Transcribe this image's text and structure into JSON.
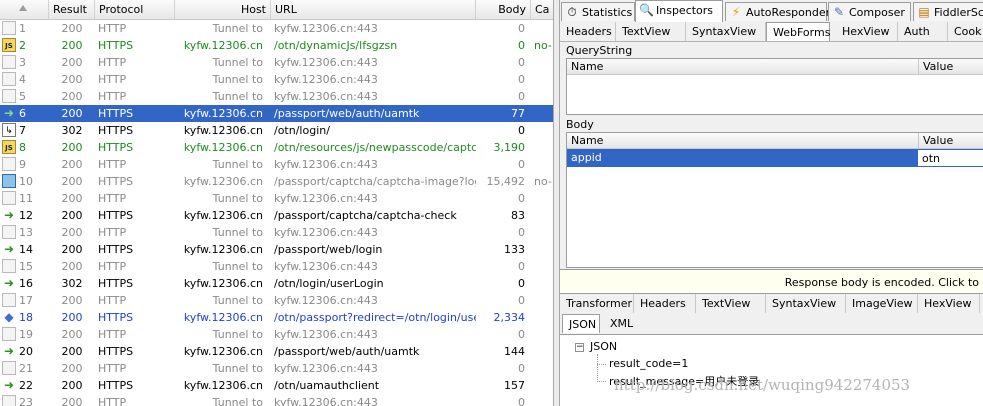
{
  "list": {
    "columns": [
      "Result",
      "Protocol",
      "Host",
      "URL",
      "Body",
      "Ca"
    ],
    "rows": [
      {
        "num": "1",
        "result": "200",
        "protocol": "HTTP",
        "host": "Tunnel to",
        "url": "kyfw.12306.cn:443",
        "body": "0",
        "cache": "",
        "icon": "tunnel",
        "color": "gray"
      },
      {
        "num": "2",
        "result": "200",
        "protocol": "HTTPS",
        "host": "kyfw.12306.cn",
        "url": "/otn/dynamicJs/lfsgzsn",
        "body": "0",
        "cache": "no-",
        "icon": "js",
        "color": "green"
      },
      {
        "num": "3",
        "result": "200",
        "protocol": "HTTP",
        "host": "Tunnel to",
        "url": "kyfw.12306.cn:443",
        "body": "0",
        "cache": "",
        "icon": "tunnel",
        "color": "gray"
      },
      {
        "num": "4",
        "result": "200",
        "protocol": "HTTP",
        "host": "Tunnel to",
        "url": "kyfw.12306.cn:443",
        "body": "0",
        "cache": "",
        "icon": "tunnel",
        "color": "gray"
      },
      {
        "num": "5",
        "result": "200",
        "protocol": "HTTP",
        "host": "Tunnel to",
        "url": "kyfw.12306.cn:443",
        "body": "0",
        "cache": "",
        "icon": "tunnel",
        "color": "gray"
      },
      {
        "num": "6",
        "result": "200",
        "protocol": "HTTPS",
        "host": "kyfw.12306.cn",
        "url": "/passport/web/auth/uamtk",
        "body": "77",
        "cache": "",
        "icon": "arrow",
        "color": "black",
        "selected": true
      },
      {
        "num": "7",
        "result": "302",
        "protocol": "HTTPS",
        "host": "kyfw.12306.cn",
        "url": "/otn/login/",
        "body": "0",
        "cache": "",
        "icon": "redir",
        "color": "black"
      },
      {
        "num": "8",
        "result": "200",
        "protocol": "HTTPS",
        "host": "kyfw.12306.cn",
        "url": "/otn/resources/js/newpasscode/captc...",
        "body": "3,190",
        "cache": "",
        "icon": "js",
        "color": "green"
      },
      {
        "num": "9",
        "result": "200",
        "protocol": "HTTP",
        "host": "Tunnel to",
        "url": "kyfw.12306.cn:443",
        "body": "0",
        "cache": "",
        "icon": "tunnel",
        "color": "gray"
      },
      {
        "num": "10",
        "result": "200",
        "protocol": "HTTPS",
        "host": "kyfw.12306.cn",
        "url": "/passport/captcha/captcha-image?logi...",
        "body": "15,492",
        "cache": "no-",
        "icon": "img",
        "color": "gray"
      },
      {
        "num": "11",
        "result": "200",
        "protocol": "HTTP",
        "host": "Tunnel to",
        "url": "kyfw.12306.cn:443",
        "body": "0",
        "cache": "",
        "icon": "tunnel",
        "color": "gray"
      },
      {
        "num": "12",
        "result": "200",
        "protocol": "HTTPS",
        "host": "kyfw.12306.cn",
        "url": "/passport/captcha/captcha-check",
        "body": "83",
        "cache": "",
        "icon": "arrow",
        "color": "black"
      },
      {
        "num": "13",
        "result": "200",
        "protocol": "HTTP",
        "host": "Tunnel to",
        "url": "kyfw.12306.cn:443",
        "body": "0",
        "cache": "",
        "icon": "tunnel",
        "color": "gray"
      },
      {
        "num": "14",
        "result": "200",
        "protocol": "HTTPS",
        "host": "kyfw.12306.cn",
        "url": "/passport/web/login",
        "body": "133",
        "cache": "",
        "icon": "arrow",
        "color": "black"
      },
      {
        "num": "15",
        "result": "200",
        "protocol": "HTTP",
        "host": "Tunnel to",
        "url": "kyfw.12306.cn:443",
        "body": "0",
        "cache": "",
        "icon": "tunnel",
        "color": "gray"
      },
      {
        "num": "16",
        "result": "302",
        "protocol": "HTTPS",
        "host": "kyfw.12306.cn",
        "url": "/otn/login/userLogin",
        "body": "0",
        "cache": "",
        "icon": "arrow",
        "color": "black"
      },
      {
        "num": "17",
        "result": "200",
        "protocol": "HTTP",
        "host": "Tunnel to",
        "url": "kyfw.12306.cn:443",
        "body": "0",
        "cache": "",
        "icon": "tunnel",
        "color": "gray"
      },
      {
        "num": "18",
        "result": "200",
        "protocol": "HTTPS",
        "host": "kyfw.12306.cn",
        "url": "/otn/passport?redirect=/otn/login/user...",
        "body": "2,334",
        "cache": "",
        "icon": "diamond",
        "color": "blue"
      },
      {
        "num": "19",
        "result": "200",
        "protocol": "HTTP",
        "host": "Tunnel to",
        "url": "kyfw.12306.cn:443",
        "body": "0",
        "cache": "",
        "icon": "tunnel",
        "color": "gray"
      },
      {
        "num": "20",
        "result": "200",
        "protocol": "HTTPS",
        "host": "kyfw.12306.cn",
        "url": "/passport/web/auth/uamtk",
        "body": "144",
        "cache": "",
        "icon": "arrow",
        "color": "black"
      },
      {
        "num": "21",
        "result": "200",
        "protocol": "HTTP",
        "host": "Tunnel to",
        "url": "kyfw.12306.cn:443",
        "body": "0",
        "cache": "",
        "icon": "tunnel",
        "color": "gray"
      },
      {
        "num": "22",
        "result": "200",
        "protocol": "HTTPS",
        "host": "kyfw.12306.cn",
        "url": "/otn/uamauthclient",
        "body": "157",
        "cache": "",
        "icon": "arrow",
        "color": "black"
      },
      {
        "num": "23",
        "result": "200",
        "protocol": "HTTP",
        "host": "Tunnel to",
        "url": "kyfw.12306.cn:443",
        "body": "0",
        "cache": "",
        "icon": "tunnel",
        "color": "gray"
      }
    ]
  },
  "colors": {
    "selected": "#3166c7",
    "gray": "#8a8a8a",
    "green": "#1e8a1e",
    "blue": "#1f3fd6",
    "black": "#000000"
  },
  "tabs": [
    {
      "label": "Statistics",
      "icon": "stopwatch-icon"
    },
    {
      "label": "Inspectors",
      "icon": "magnifier-icon",
      "active": true
    },
    {
      "label": "AutoResponder",
      "icon": "lightning-icon"
    },
    {
      "label": "Composer",
      "icon": "compose-icon"
    },
    {
      "label": "FiddlerSc",
      "icon": "script-icon"
    }
  ],
  "request_tabs": [
    "Headers",
    "TextView",
    "SyntaxView",
    "WebForms",
    "HexView",
    "Auth",
    "Cook"
  ],
  "request_active": "WebForms",
  "querystring": {
    "title": "QueryString",
    "col_name": "Name",
    "col_value": "Value"
  },
  "body": {
    "title": "Body",
    "col_name": "Name",
    "col_value": "Value",
    "rows": [
      {
        "name": "appid",
        "value": "otn"
      }
    ]
  },
  "notice": "Response body is encoded. Click to",
  "response_tabs": [
    "Transformer",
    "Headers",
    "TextView",
    "SyntaxView",
    "ImageView",
    "HexView"
  ],
  "response_subtabs": [
    "JSON",
    "XML"
  ],
  "json": {
    "root": "JSON",
    "items": [
      "result_code=1",
      "result_message=用户未登录"
    ]
  },
  "watermark": "http://blog.csdn.net/wuqing942274053"
}
